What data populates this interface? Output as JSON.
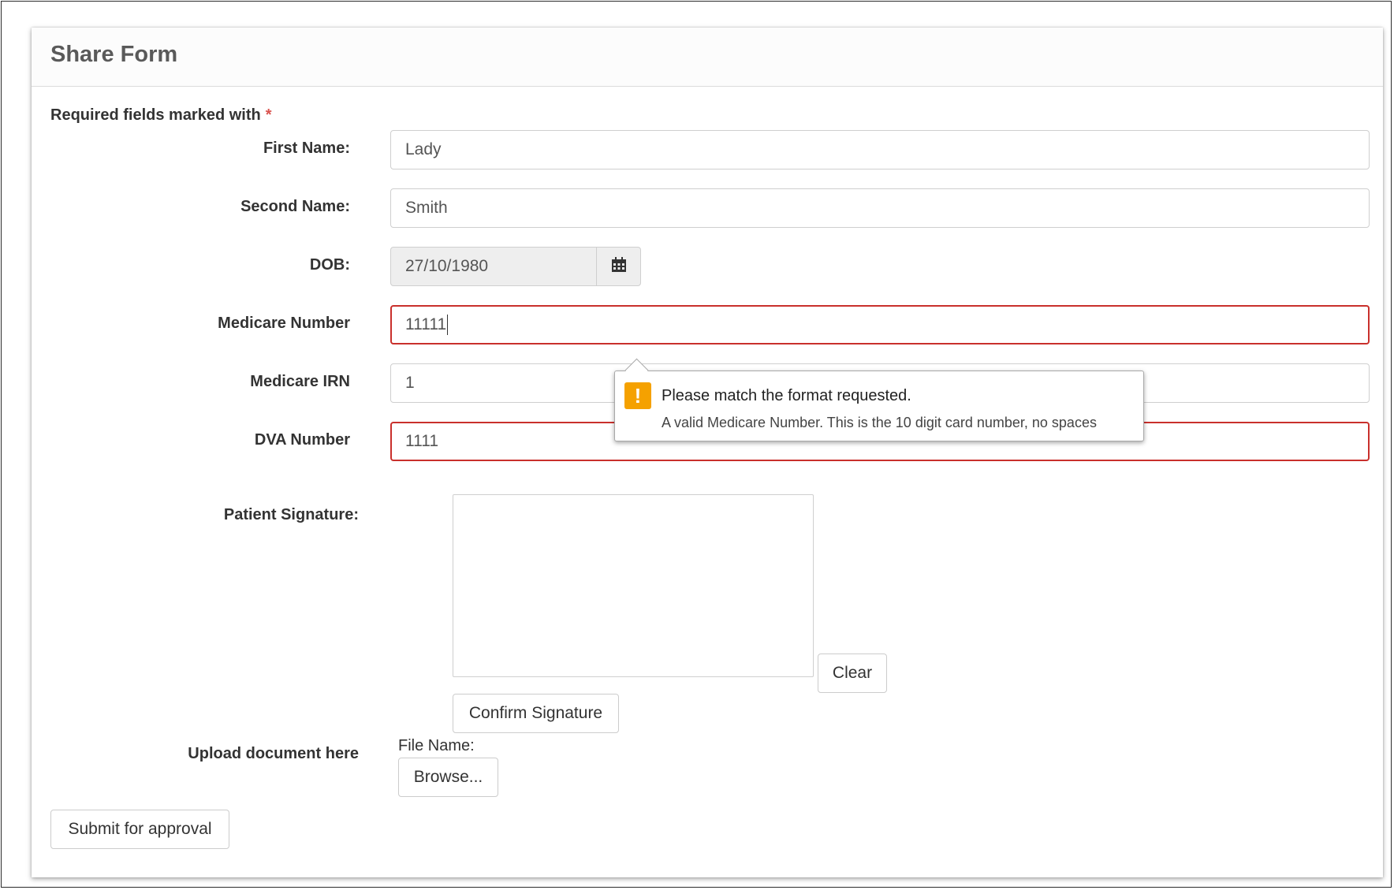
{
  "form": {
    "title": "Share Form",
    "required_note": "Required fields marked with",
    "required_marker": "*"
  },
  "fields": {
    "first_name": {
      "label": "First Name:",
      "value": "Lady"
    },
    "second_name": {
      "label": "Second Name:",
      "value": "Smith"
    },
    "dob": {
      "label": "DOB:",
      "value": "27/10/1980",
      "icon": "calendar-icon"
    },
    "medicare_number": {
      "label": "Medicare Number",
      "value": "11111",
      "state": "invalid"
    },
    "medicare_irn": {
      "label": "Medicare IRN",
      "value": "1"
    },
    "dva_number": {
      "label": "DVA Number",
      "value": "1111",
      "state": "invalid"
    }
  },
  "signature": {
    "label": "Patient Signature:",
    "clear_label": "Clear",
    "confirm_label": "Confirm Signature"
  },
  "upload": {
    "label": "Upload document here",
    "file_name_label": "File Name:",
    "browse_label": "Browse..."
  },
  "submit_label": "Submit for approval",
  "validation_tooltip": {
    "icon": "warning-icon",
    "title": "Please match the format requested.",
    "detail": "A valid Medicare Number. This is the 10 digit card number, no spaces"
  },
  "colors": {
    "invalid_border": "#c9302c",
    "required_star": "#d9534f",
    "warning_icon": "#f5a100"
  }
}
